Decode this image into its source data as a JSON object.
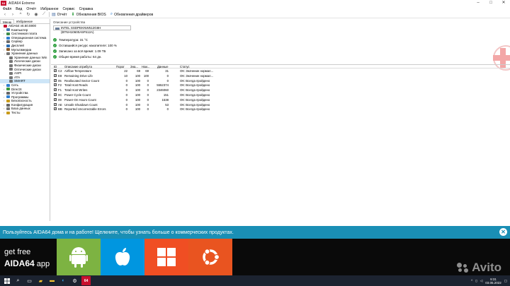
{
  "window": {
    "logo": "64",
    "title": "AIDA64 Extreme",
    "controls": [
      "–",
      "□",
      "✕"
    ]
  },
  "menu": [
    "Файл",
    "Вид",
    "Отчёт",
    "Избранное",
    "Сервис",
    "Справка"
  ],
  "toolbar": {
    "report_label": "Отчёт",
    "bios_update_label": "Обновления BIOS",
    "driver_update_label": "Обновления драйверов"
  },
  "sidebar": {
    "tabs": [
      "Меню",
      "Избранное"
    ],
    "items": [
      {
        "label": "AIDA64 v6.60.5900",
        "indent": 0,
        "exp": "",
        "color": "#c8102e"
      },
      {
        "label": "Компьютер",
        "indent": 1,
        "exp": "›",
        "color": "#4a7ab5"
      },
      {
        "label": "Системная плата",
        "indent": 1,
        "exp": "›",
        "color": "#3d8c4a"
      },
      {
        "label": "Операционная система",
        "indent": 1,
        "exp": "›",
        "color": "#2f7fd0"
      },
      {
        "label": "Сервер",
        "indent": 1,
        "exp": "›",
        "color": "#6a6a6a"
      },
      {
        "label": "Дисплей",
        "indent": 1,
        "exp": "›",
        "color": "#2a6db2"
      },
      {
        "label": "Мультимедиа",
        "indent": 1,
        "exp": "›",
        "color": "#8a5a2a"
      },
      {
        "label": "Хранение данных",
        "indent": 1,
        "exp": "⌄",
        "color": "#777"
      },
      {
        "label": "Хранение данных Win",
        "indent": 2,
        "exp": "",
        "color": "#777"
      },
      {
        "label": "Логические диски",
        "indent": 2,
        "exp": "",
        "color": "#777"
      },
      {
        "label": "Физические диски",
        "indent": 2,
        "exp": "",
        "color": "#777"
      },
      {
        "label": "Оптические диски",
        "indent": 2,
        "exp": "",
        "color": "#777"
      },
      {
        "label": "ASPI",
        "indent": 2,
        "exp": "",
        "color": "#777"
      },
      {
        "label": "ATA",
        "indent": 2,
        "exp": "",
        "color": "#777"
      },
      {
        "label": "SMART",
        "indent": 2,
        "exp": "",
        "color": "#777",
        "selected": true
      },
      {
        "label": "Сеть",
        "indent": 1,
        "exp": "›",
        "color": "#2f7fd0"
      },
      {
        "label": "DirectX",
        "indent": 1,
        "exp": "›",
        "color": "#3a9a3a"
      },
      {
        "label": "Устройства",
        "indent": 1,
        "exp": "›",
        "color": "#666"
      },
      {
        "label": "Программы",
        "indent": 1,
        "exp": "›",
        "color": "#2f7fd0"
      },
      {
        "label": "Безопасность",
        "indent": 1,
        "exp": "›",
        "color": "#c89a1a"
      },
      {
        "label": "Конфигурация",
        "indent": 1,
        "exp": "›",
        "color": "#666"
      },
      {
        "label": "База данных",
        "indent": 1,
        "exp": "›",
        "color": "#777"
      },
      {
        "label": "Тесты",
        "indent": 1,
        "exp": "›",
        "color": "#c89a1a"
      }
    ]
  },
  "main": {
    "device_label": "Описание устройства",
    "device_value": "INTEL SSDPEKNW512G8H (BTNH10600A5F512A)",
    "status": [
      "Температура: 31 °C",
      "Оставшийся ресурс накопителя: 100 %",
      "Записано за всё время: 1.09 ТБ",
      "Общее время работы: 64 дн."
    ],
    "columns": [
      "ID",
      "Описание атрибута",
      "Порог",
      "Зна...",
      "Наи...",
      "Данные",
      "Статус"
    ],
    "rows": [
      [
        "C2",
        "Airflow Temperature",
        "22",
        "69",
        "69",
        "31",
        "ОК: Значение нормал..."
      ],
      [
        "E8",
        "Remaining Drive Life",
        "10",
        "100",
        "100",
        "0",
        "ОК: Значение нормал..."
      ],
      [
        "05",
        "Reallocated Sector Count",
        "0",
        "100",
        "0",
        "0",
        "ОК: Всегда пройдено"
      ],
      [
        "F2",
        "Total Host Reads",
        "0",
        "100",
        "0",
        "5552374",
        "ОК: Всегда пройдено"
      ],
      [
        "F1",
        "Total Host Writes",
        "0",
        "100",
        "0",
        "2346060",
        "ОК: Всегда пройдено"
      ],
      [
        "0C",
        "Power Cycle Count",
        "0",
        "100",
        "0",
        "151",
        "ОК: Всегда пройдено"
      ],
      [
        "09",
        "Power-On Hours Count",
        "0",
        "100",
        "0",
        "1538",
        "ОК: Всегда пройдено"
      ],
      [
        "AE",
        "Unsafe Shutdown Count",
        "0",
        "100",
        "0",
        "53",
        "ОК: Всегда пройдено"
      ],
      [
        "BB",
        "Reported Uncorrectable Errors",
        "0",
        "100",
        "0",
        "0",
        "ОК: Всегда пройдено"
      ]
    ]
  },
  "banner": {
    "text": "Пользуйтесь AIDA64 дома и на работе! Щелкните, чтобы узнать больше о коммерческих продуктах.",
    "close": "✕"
  },
  "ad": {
    "line1": "get free",
    "brand": "AIDA64",
    "suffix": " app",
    "watermark": "Avito"
  },
  "taskbar": {
    "time": "9:31",
    "date": "03.05.2022"
  }
}
